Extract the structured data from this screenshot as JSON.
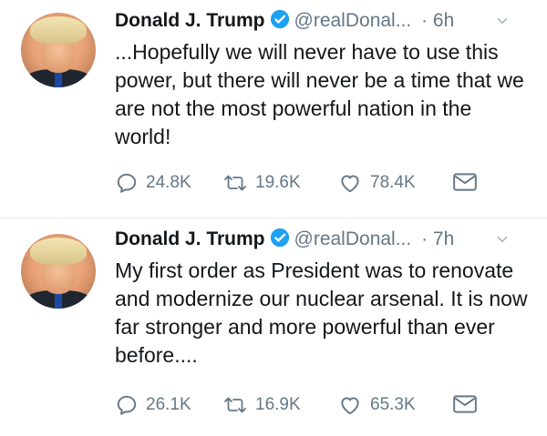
{
  "tweets": [
    {
      "name": "Donald J. Trump",
      "handle": "@realDonal...",
      "time": "· 6h",
      "text": "...Hopefully we will never have to use this power, but there will never be a time that we are not the most powerful nation in the world!",
      "replies": "24.8K",
      "retweets": "19.6K",
      "likes": "78.4K"
    },
    {
      "name": "Donald J. Trump",
      "handle": "@realDonal...",
      "time": "· 7h",
      "text": "My first order as President was to renovate and modernize our nuclear arsenal. It is now far stronger and more powerful than ever before....",
      "replies": "26.1K",
      "retweets": "16.9K",
      "likes": "65.3K"
    }
  ],
  "colors": {
    "verified": "#1da1f2",
    "secondary_text": "#657786",
    "divider": "#e6ecf0"
  },
  "icons": [
    "verified-badge-icon",
    "chevron-down-icon",
    "reply-icon",
    "retweet-icon",
    "like-icon",
    "message-icon"
  ]
}
